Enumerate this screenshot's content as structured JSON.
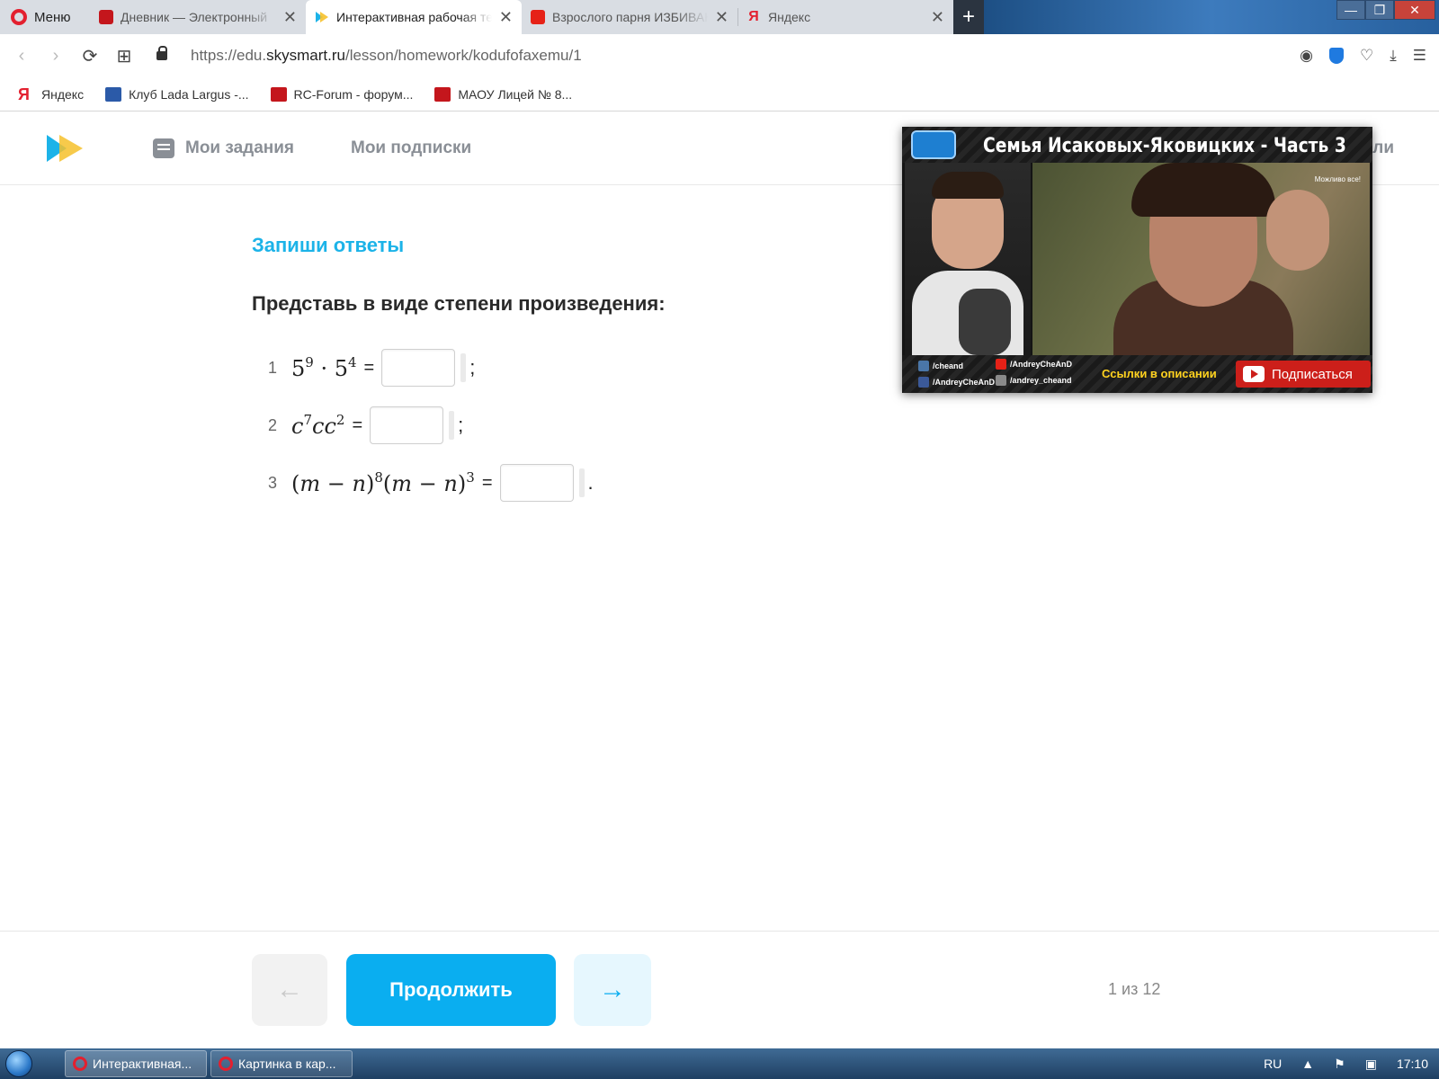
{
  "browser": {
    "menu_label": "Меню",
    "tabs": [
      {
        "title": "Дневник — Электронный",
        "favicon": "diary-icon"
      },
      {
        "title": "Интерактивная рабочая тетрадь",
        "favicon": "skysmart-icon",
        "active": true
      },
      {
        "title": "Взрослого парня ИЗБИВАЮТ",
        "favicon": "youtube-icon"
      },
      {
        "title": "Яндекс",
        "favicon": "yandex-icon"
      }
    ],
    "close_glyph": "✕",
    "new_tab_glyph": "+",
    "window_controls": [
      "—",
      "❐",
      "✕"
    ]
  },
  "addressbar": {
    "url_prefix": "https://edu.",
    "url_domain": "skysmart.ru",
    "url_path": "/lesson/homework/kodufofaxemu/1"
  },
  "bookmarks": [
    {
      "label": "Яндекс",
      "icon": "yandex-icon",
      "color": "#e3202f"
    },
    {
      "label": "Клуб Lada Largus -...",
      "icon": "lada-icon",
      "color": "#2b5aa8"
    },
    {
      "label": "RC-Forum - форум...",
      "icon": "rc-icon",
      "color": "#c4161c"
    },
    {
      "label": "МАОУ Лицей № 8...",
      "icon": "school-icon",
      "color": "#c4161c"
    }
  ],
  "site": {
    "nav": [
      {
        "label": "Мои задания",
        "icon": "tasks-icon"
      },
      {
        "label": "Мои подписки"
      }
    ],
    "nav_right_partial": "ли"
  },
  "lesson": {
    "heading": "Запиши ответы",
    "task": "Представь в виде степени произведения:",
    "exercises": [
      {
        "num": "1",
        "punct": ";"
      },
      {
        "num": "2",
        "punct": ";"
      },
      {
        "num": "3",
        "punct": "."
      }
    ],
    "equals": "="
  },
  "footer": {
    "prev_glyph": "←",
    "continue_label": "Продолжить",
    "next_glyph": "→",
    "pager": "1 из 12"
  },
  "video": {
    "title": "Семья Исаковых-Яковицких - Часть 3",
    "corner_text": "Можливо все!",
    "socials": [
      {
        "label": "/cheand",
        "icon": "vk-icon"
      },
      {
        "label": "/AndreyCheAnD",
        "icon": "youtube-icon"
      },
      {
        "label": "/AndreyCheAnD",
        "icon": "facebook-icon"
      },
      {
        "label": "/andrey_cheand",
        "icon": "instagram-icon"
      }
    ],
    "links_label": "Ссылки в описании",
    "subscribe_label": "Подписаться"
  },
  "taskbar": {
    "tasks": [
      "Интерактивная...",
      "Картинка в кар..."
    ],
    "lang": "RU",
    "time": "17:10"
  },
  "colors": {
    "accent": "#0aaef0",
    "heading": "#1cb3e8",
    "subscribe": "#cc1f1a"
  }
}
